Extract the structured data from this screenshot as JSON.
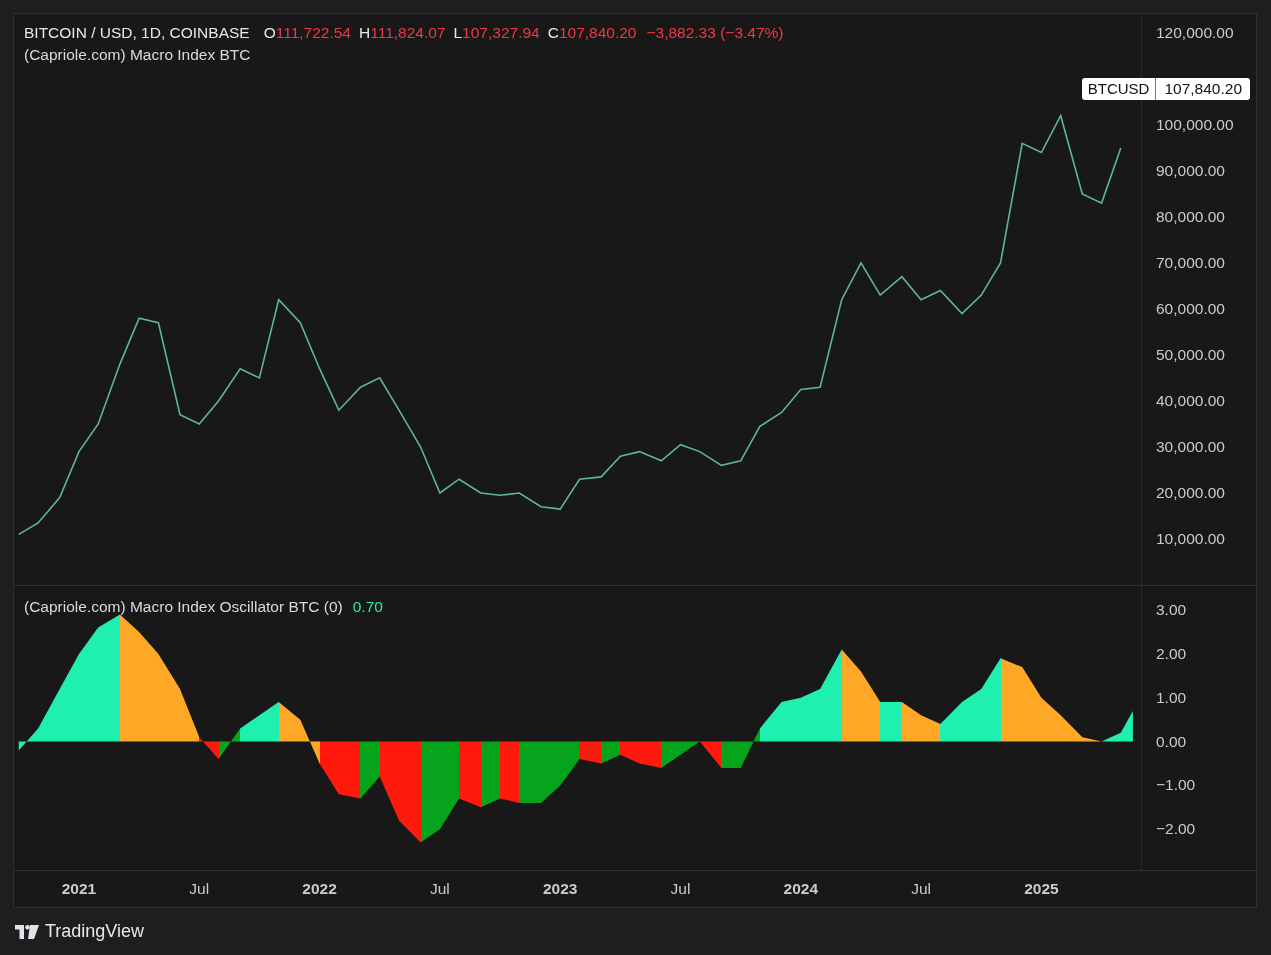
{
  "header": {
    "symbol": "BITCOIN / USD, 1D, COINBASE",
    "ohlc": [
      {
        "label": "O",
        "value": "111,722.54"
      },
      {
        "label": "H",
        "value": "111,824.07"
      },
      {
        "label": "L",
        "value": "107,327.94"
      },
      {
        "label": "C",
        "value": "107,840.20"
      }
    ],
    "change": "−3,882.33 (−3.47%)",
    "indicator": "(Capriole.com) Macro Index BTC"
  },
  "price_pane": {
    "price_tag": {
      "symbol": "BTCUSD",
      "price": "107,840.20"
    },
    "chart_data": {
      "type": "line",
      "x": [
        2020.75,
        2020.83,
        2020.92,
        2021.0,
        2021.08,
        2021.17,
        2021.25,
        2021.33,
        2021.42,
        2021.5,
        2021.58,
        2021.67,
        2021.75,
        2021.83,
        2021.92,
        2022.0,
        2022.08,
        2022.17,
        2022.25,
        2022.33,
        2022.42,
        2022.5,
        2022.58,
        2022.67,
        2022.75,
        2022.83,
        2022.92,
        2023.0,
        2023.08,
        2023.17,
        2023.25,
        2023.33,
        2023.42,
        2023.5,
        2023.58,
        2023.67,
        2023.75,
        2023.83,
        2023.92,
        2024.0,
        2024.08,
        2024.17,
        2024.25,
        2024.33,
        2024.42,
        2024.5,
        2024.58,
        2024.67,
        2024.75,
        2024.83,
        2024.92,
        2025.0,
        2025.08,
        2025.17,
        2025.25,
        2025.33
      ],
      "series": [
        {
          "color": "#5fb3a3",
          "values": [
            11000,
            13500,
            19000,
            29000,
            35000,
            48000,
            58000,
            57000,
            37000,
            35000,
            40000,
            47000,
            45000,
            62000,
            57000,
            47000,
            38000,
            43000,
            45000,
            38000,
            30000,
            20000,
            23000,
            20000,
            19500,
            20000,
            17000,
            16500,
            23000,
            23500,
            28000,
            29000,
            27000,
            30500,
            29000,
            26000,
            27000,
            34500,
            37500,
            42500,
            43000,
            62000,
            70000,
            63000,
            67000,
            62000,
            64000,
            59000,
            63000,
            70000,
            96000,
            94000,
            102000,
            85000,
            83000,
            95000
          ]
        }
      ],
      "xlim": [
        2020.73,
        2025.9
      ],
      "ylim": [
        0,
        124100
      ],
      "yticks": [
        {
          "value": 120000,
          "label": "120,000.00"
        },
        {
          "value": 100000,
          "label": "100,000.00"
        },
        {
          "value": 90000,
          "label": "90,000.00"
        },
        {
          "value": 80000,
          "label": "80,000.00"
        },
        {
          "value": 70000,
          "label": "70,000.00"
        },
        {
          "value": 60000,
          "label": "60,000.00"
        },
        {
          "value": 50000,
          "label": "50,000.00"
        },
        {
          "value": 40000,
          "label": "40,000.00"
        },
        {
          "value": 30000,
          "label": "30,000.00"
        },
        {
          "value": 20000,
          "label": "20,000.00"
        },
        {
          "value": 10000,
          "label": "10,000.00"
        }
      ]
    }
  },
  "oscillator_pane": {
    "legend": {
      "name": "(Capriole.com) Macro Index Oscillator BTC (0)",
      "value": "0.70"
    },
    "chart_data": {
      "type": "area",
      "x": [
        2020.75,
        2020.83,
        2020.92,
        2021.0,
        2021.08,
        2021.17,
        2021.25,
        2021.33,
        2021.42,
        2021.5,
        2021.58,
        2021.67,
        2021.75,
        2021.83,
        2021.92,
        2022.0,
        2022.08,
        2022.17,
        2022.25,
        2022.33,
        2022.42,
        2022.5,
        2022.58,
        2022.67,
        2022.75,
        2022.83,
        2022.92,
        2023.0,
        2023.08,
        2023.17,
        2023.25,
        2023.33,
        2023.42,
        2023.5,
        2023.58,
        2023.67,
        2023.75,
        2023.83,
        2023.92,
        2024.0,
        2024.08,
        2024.17,
        2024.25,
        2024.33,
        2024.42,
        2024.5,
        2024.58,
        2024.67,
        2024.75,
        2024.83,
        2024.92,
        2025.0,
        2025.08,
        2025.17,
        2025.25,
        2025.33,
        2025.38
      ],
      "series": [
        {
          "color": "#1ff0b0",
          "values": [
            -0.2,
            0.3,
            1.2,
            2.0,
            2.6,
            2.9,
            2.5,
            2.0,
            1.2,
            0.1,
            -0.4,
            0.3,
            0.6,
            0.9,
            0.5,
            -0.5,
            -1.2,
            -1.3,
            -0.8,
            -1.8,
            -2.3,
            -2.0,
            -1.3,
            -1.5,
            -1.3,
            -1.4,
            -1.4,
            -1.0,
            -0.4,
            -0.5,
            -0.3,
            -0.5,
            -0.6,
            -0.3,
            0.0,
            -0.6,
            -0.6,
            0.3,
            0.9,
            1.0,
            1.2,
            2.1,
            1.6,
            0.9,
            0.9,
            0.6,
            0.4,
            0.9,
            1.2,
            1.9,
            1.7,
            1.0,
            0.6,
            0.1,
            0.0,
            0.2,
            0.7
          ]
        }
      ],
      "xlim": [
        2020.73,
        2025.9
      ],
      "ylim": [
        -2.93,
        3.55
      ],
      "yticks": [
        {
          "value": 3,
          "label": "3.00"
        },
        {
          "value": 2,
          "label": "2.00"
        },
        {
          "value": 1,
          "label": "1.00"
        },
        {
          "value": 0,
          "label": "0.00"
        },
        {
          "value": -1,
          "label": "−1.00"
        },
        {
          "value": -2,
          "label": "−2.00"
        }
      ],
      "xticks": [
        {
          "value": 2021,
          "label": "2021"
        },
        {
          "value": 2021.5,
          "label": "Jul"
        },
        {
          "value": 2022,
          "label": "2022"
        },
        {
          "value": 2022.5,
          "label": "Jul"
        },
        {
          "value": 2023,
          "label": "2023"
        },
        {
          "value": 2023.5,
          "label": "Jul"
        },
        {
          "value": 2024,
          "label": "2024"
        },
        {
          "value": 2024.5,
          "label": "Jul"
        },
        {
          "value": 2025,
          "label": "2025"
        }
      ]
    }
  },
  "footer": {
    "brand": "TradingView"
  }
}
